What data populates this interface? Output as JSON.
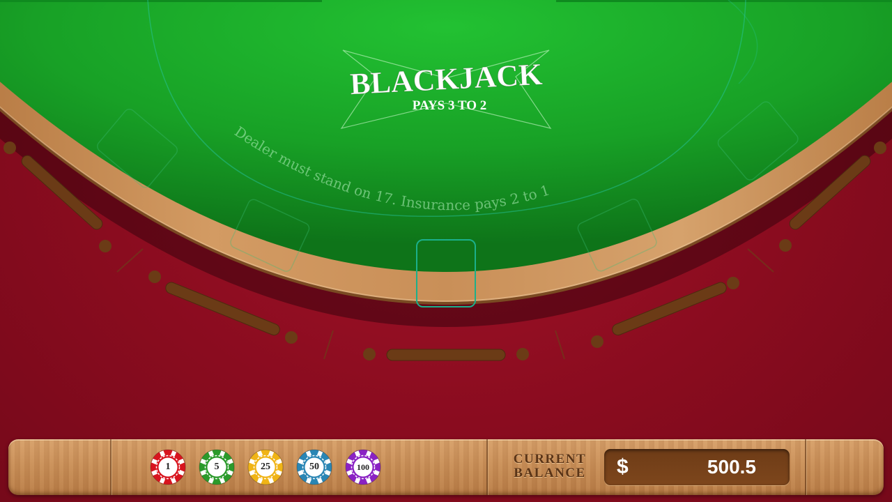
{
  "table": {
    "title": "BLACKJACK",
    "subtitle": "PAYS 3 TO 2",
    "rules_text": "Dealer must stand on 17. Insurance pays 2 to 1"
  },
  "chips": [
    {
      "label": "1",
      "color": "#d8141e"
    },
    {
      "label": "5",
      "color": "#2b9a2b"
    },
    {
      "label": "25",
      "color": "#f0b416"
    },
    {
      "label": "50",
      "color": "#2a86b4"
    },
    {
      "label": "100",
      "color": "#8a22c4"
    }
  ],
  "balance": {
    "label_line1": "CURRENT",
    "label_line2": "BALANCE",
    "currency": "$",
    "value": "500.5"
  },
  "colors": {
    "felt": "#1fae2c",
    "felt_dark": "#0d6a18",
    "background": "#8a0c1f",
    "rail_wood": "#c78e55",
    "spot_outline": "#1bb08b"
  }
}
